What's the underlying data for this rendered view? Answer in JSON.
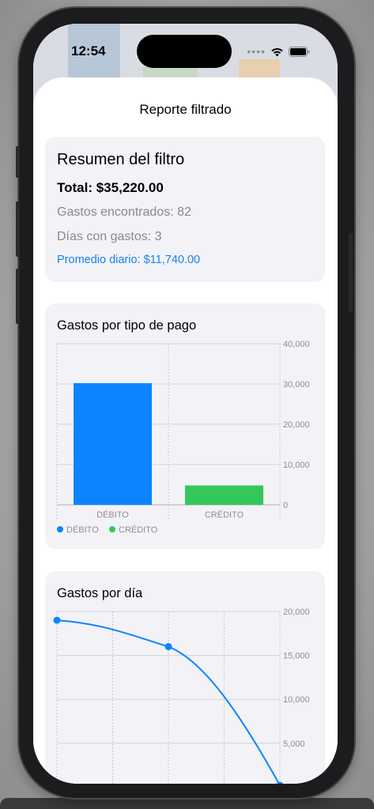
{
  "status_bar": {
    "time": "12:54",
    "signal": "••••",
    "icons": [
      "wifi-icon",
      "battery-icon"
    ]
  },
  "sheet": {
    "title": "Reporte filtrado"
  },
  "summary": {
    "heading": "Resumen del filtro",
    "total": "Total: $35,220.00",
    "found": "Gastos encontrados: 82",
    "days": "Días con gastos: 3",
    "average": "Promedio diario: $11,740.00"
  },
  "colors": {
    "accent_blue": "#0a84ff",
    "green": "#34c759",
    "card_bg": "#f2f2f7"
  },
  "chart_data": [
    {
      "type": "bar",
      "title": "Gastos por tipo de pago",
      "categories": [
        "DÉBITO",
        "CRÉDITO"
      ],
      "values": [
        30200,
        4800
      ],
      "colors": [
        "#0a84ff",
        "#34c759"
      ],
      "ylim": [
        0,
        40000
      ],
      "yticks": [
        "40,000",
        "30,000",
        "20,000",
        "10,000",
        "0"
      ],
      "ytick_values": [
        40000,
        30000,
        20000,
        10000,
        0
      ],
      "legend": [
        "DÉBITO",
        "CRÉDITO"
      ],
      "legend_placement": "bottom-left",
      "grid": true
    },
    {
      "type": "line",
      "title": "Gastos por día",
      "x": [
        0,
        1,
        2
      ],
      "values": [
        19000,
        16000,
        220
      ],
      "ylim": [
        0,
        20000
      ],
      "yticks": [
        "20,000",
        "15,000",
        "10,000",
        "5,000"
      ],
      "ytick_values": [
        20000,
        15000,
        10000,
        5000
      ],
      "color": "#0a84ff",
      "grid": true
    }
  ]
}
